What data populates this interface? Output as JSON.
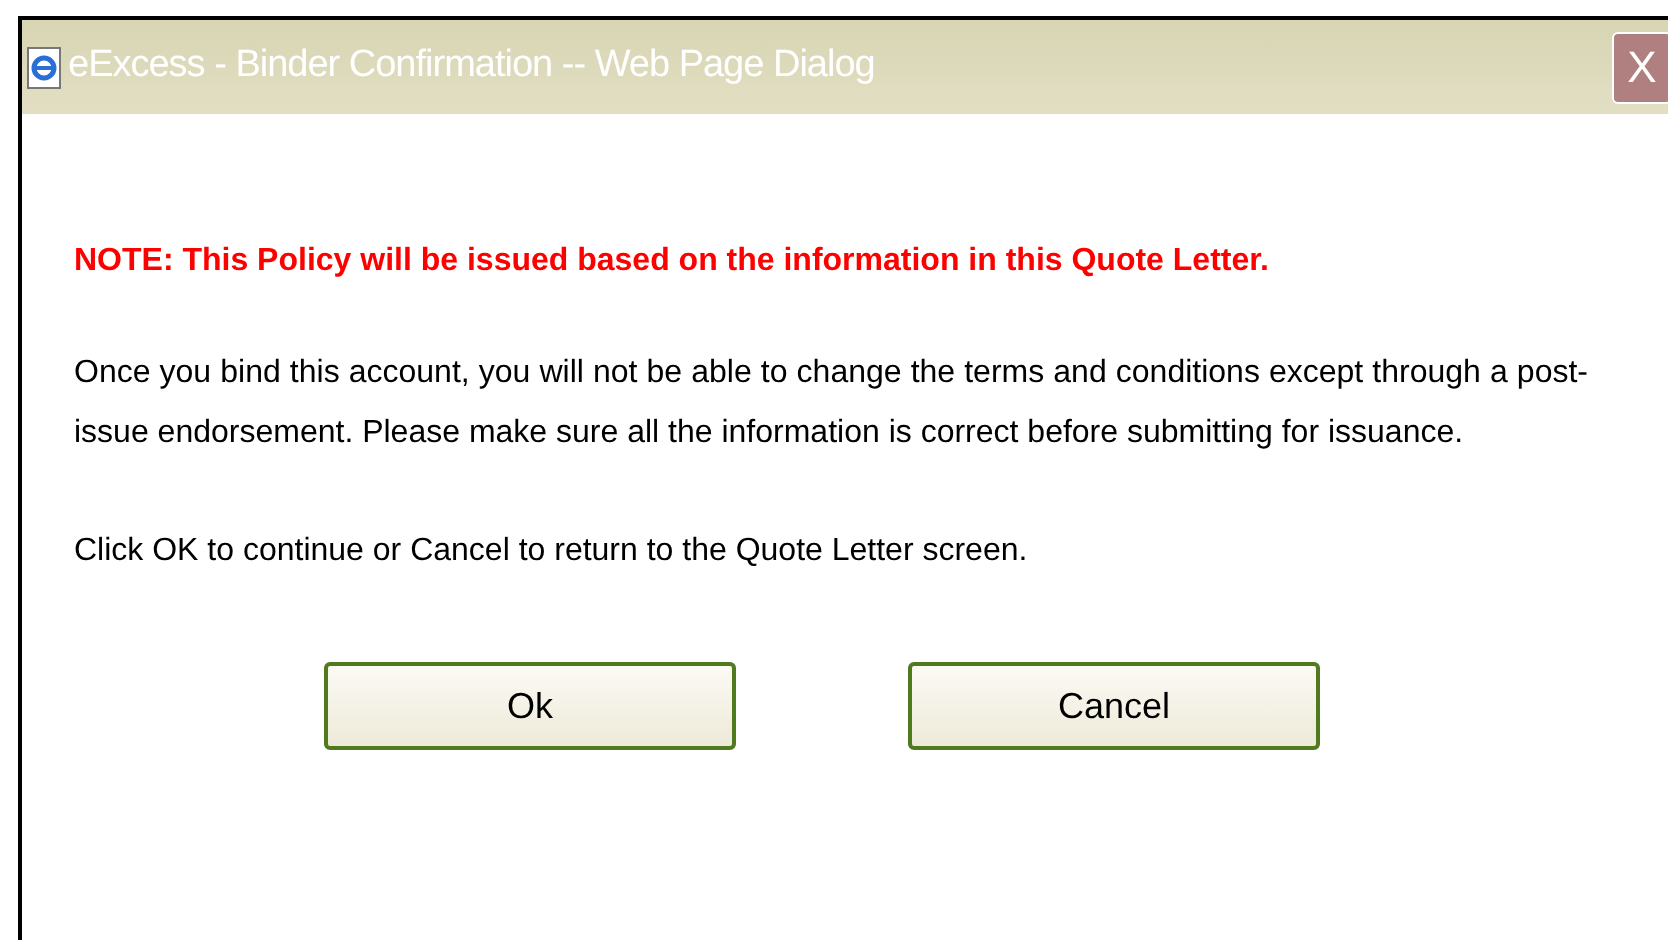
{
  "window": {
    "title": "eExcess - Binder Confirmation -- Web Page Dialog",
    "close_label": "X"
  },
  "note": "NOTE: This Policy will be issued based on the information in this Quote Letter.",
  "paragraphs": [
    "Once you bind this account, you will not be able to change the terms and conditions except through a post-issue endorsement. Please make sure all the information is correct before submitting for issuance.",
    "Click OK to continue or Cancel to return to the Quote Letter screen."
  ],
  "buttons": [
    "Ok",
    "Cancel"
  ]
}
